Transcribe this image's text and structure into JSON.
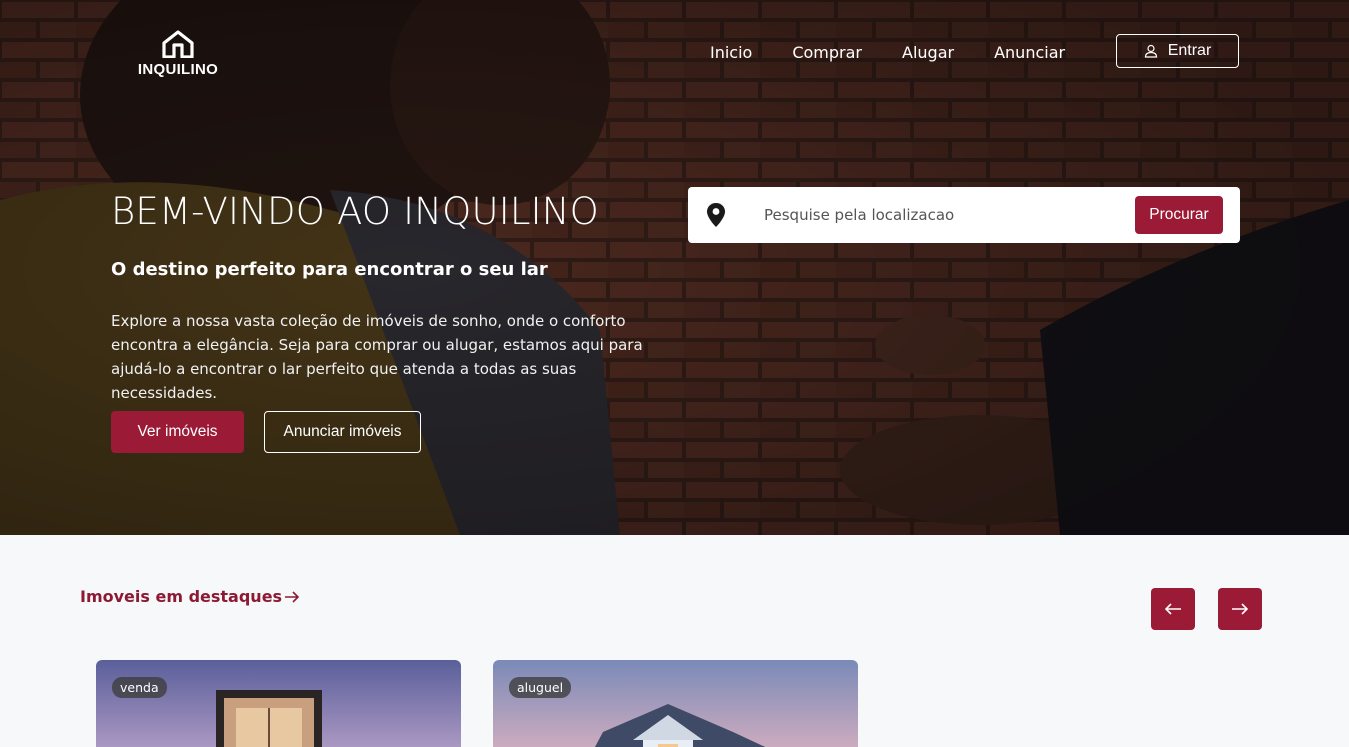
{
  "brand": {
    "name": "INQUILINO"
  },
  "nav": {
    "links": [
      "Inicio",
      "Comprar",
      "Alugar",
      "Anunciar"
    ],
    "login_label": "Entrar"
  },
  "hero": {
    "title": "BEM-VINDO AO INQUILINO",
    "subtitle": "O destino perfeito para encontrar o seu lar",
    "description": "Explore a nossa vasta coleção de imóveis de sonho, onde o conforto encontra a elegância. Seja para comprar ou alugar, estamos aqui para ajudá-lo a encontrar o lar perfeito que atenda a todas as suas necessidades.",
    "primary_button": "Ver imóveis",
    "secondary_button": "Anunciar imóveis"
  },
  "search": {
    "placeholder": "Pesquise pela localizacao",
    "button": "Procurar"
  },
  "featured": {
    "title": "Imoveis em destaques",
    "prev_icon": "arrow-left-icon",
    "next_icon": "arrow-right-icon",
    "cards": [
      {
        "badge": "venda"
      },
      {
        "badge": "aluguel"
      }
    ]
  },
  "colors": {
    "accent": "#9b1a36",
    "section_title": "#8c1a33",
    "background": "#f7f8fa"
  }
}
